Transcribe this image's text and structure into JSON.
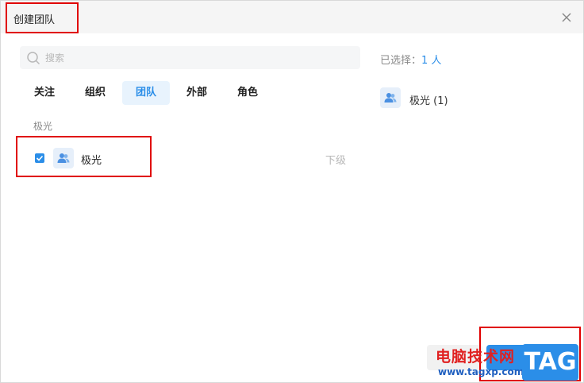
{
  "dialog": {
    "title": "创建团队"
  },
  "search": {
    "placeholder": "搜索"
  },
  "tabs": [
    {
      "label": "关注",
      "active": false
    },
    {
      "label": "组织",
      "active": false
    },
    {
      "label": "团队",
      "active": true
    },
    {
      "label": "外部",
      "active": false
    },
    {
      "label": "角色",
      "active": false
    }
  ],
  "list": {
    "section_label": "极光",
    "items": [
      {
        "name": "极光",
        "checked": true,
        "sub_link": "下级",
        "icon": "team-icon"
      }
    ]
  },
  "selected": {
    "prefix": "已选择：",
    "count": "1 人",
    "items": [
      {
        "label": "极光 (1)",
        "icon": "team-icon"
      }
    ]
  },
  "watermark": {
    "site_name": "电脑技术网",
    "url": "www.tagxp.com",
    "badge": "TAG"
  },
  "colors": {
    "accent": "#2b8ee8",
    "highlight_outline": "#e00000",
    "titlebar_bg": "#f5f5f5"
  }
}
